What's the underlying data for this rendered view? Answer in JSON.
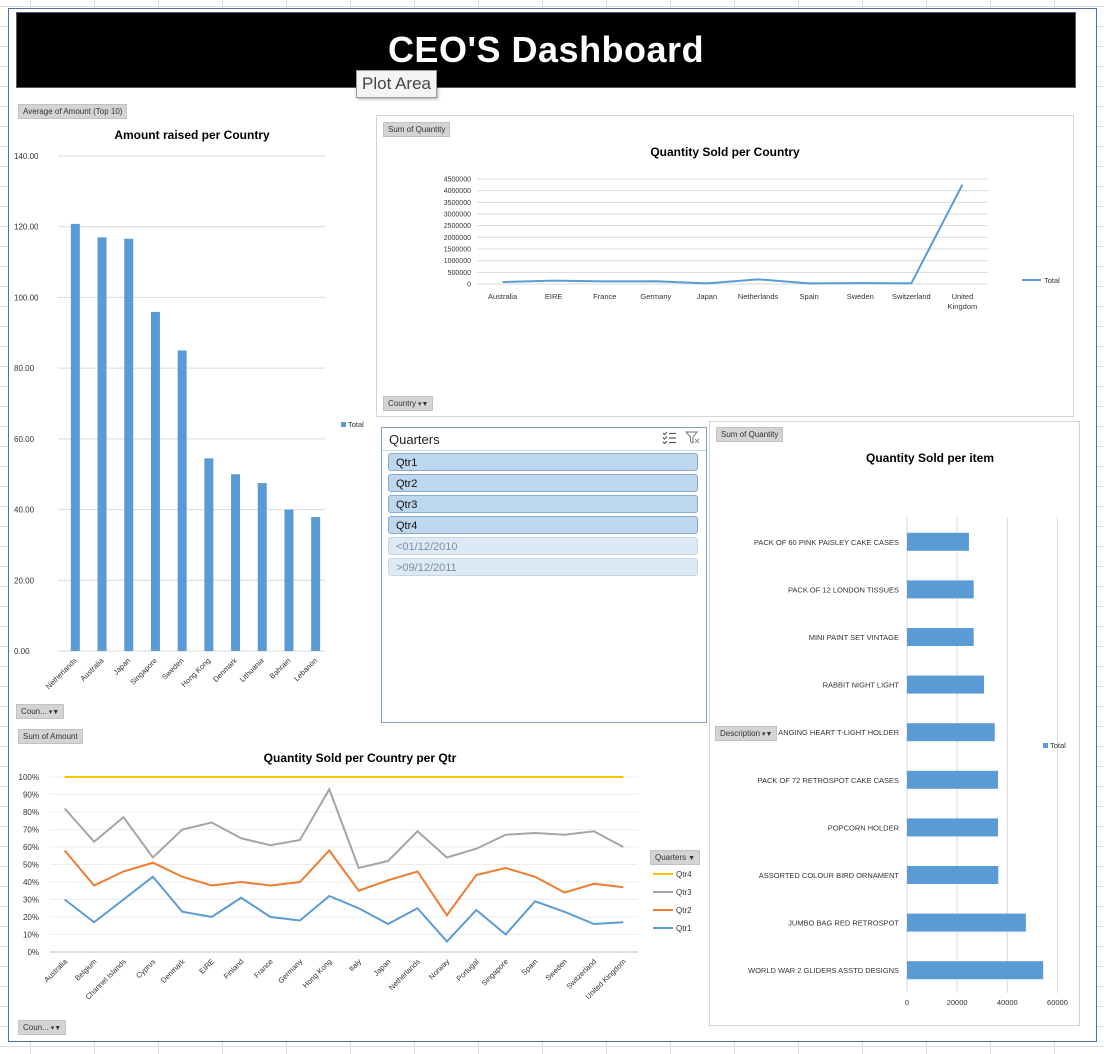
{
  "dashboard": {
    "title": "CEO'S Dashboard",
    "tooltip": "Plot Area"
  },
  "colors": {
    "bar_blue": "#5b9bd5",
    "qtr1": "#5b9bd5",
    "qtr2": "#ed7d31",
    "qtr3": "#a5a5a5",
    "qtr4": "#ffc000",
    "gridline": "#d9d9d9"
  },
  "amount_chart": {
    "field_button": "Average of Amount (Top 10)",
    "axis_button": "Coun...",
    "legend": "Total"
  },
  "quantity_country_chart": {
    "field_button": "Sum of Quantity",
    "axis_button": "Country",
    "legend": "Total"
  },
  "item_chart": {
    "field_button": "Sum of Quantity",
    "axis_button": "Description",
    "legend": "Total"
  },
  "qtr_chart": {
    "field_button": "Sum of Amount",
    "axis_button": "Coun...",
    "legend_button": "Quarters"
  },
  "slicer": {
    "title": "Quarters",
    "icons": [
      "multi-select-icon",
      "clear-filter-icon"
    ],
    "items": [
      {
        "label": "Qtr1",
        "selected": true
      },
      {
        "label": "Qtr2",
        "selected": true
      },
      {
        "label": "Qtr3",
        "selected": true
      },
      {
        "label": "Qtr4",
        "selected": true
      },
      {
        "label": "<01/12/2010",
        "selected": false
      },
      {
        "label": ">09/12/2011",
        "selected": false
      }
    ]
  },
  "chart_data": [
    {
      "type": "bar",
      "title": "Amount raised per Country",
      "categories": [
        "Netherlands",
        "Australia",
        "Japan",
        "Singapore",
        "Sweden",
        "Hong Kong",
        "Denmark",
        "Lithuania",
        "Bahrain",
        "Lebanon"
      ],
      "series": [
        {
          "name": "Total",
          "values": [
            120.8,
            117.0,
            116.6,
            95.9,
            85.0,
            54.5,
            50.0,
            47.5,
            40.0,
            37.9
          ]
        }
      ],
      "yticks": [
        "0.00",
        "20.00",
        "40.00",
        "60.00",
        "80.00",
        "100.00",
        "120.00",
        "140.00"
      ],
      "ylim": [
        0,
        140
      ],
      "legend": "right"
    },
    {
      "type": "line",
      "title": "Quantity Sold per Country",
      "categories": [
        "Australia",
        "EIRE",
        "France",
        "Germany",
        "Japan",
        "Netherlands",
        "Spain",
        "Sweden",
        "Switzerland",
        "United Kingdom"
      ],
      "series": [
        {
          "name": "Total",
          "values": [
            83000,
            142000,
            111000,
            117000,
            26000,
            200000,
            27000,
            36000,
            30000,
            4260000
          ]
        }
      ],
      "yticks": [
        "0",
        "500000",
        "1000000",
        "1500000",
        "2000000",
        "2500000",
        "3000000",
        "3500000",
        "4000000",
        "4500000"
      ],
      "ylim": [
        0,
        4500000
      ],
      "legend": "right"
    },
    {
      "type": "bar",
      "orientation": "horizontal",
      "title": "Quantity Sold per item",
      "categories": [
        "PACK OF 60 PINK PAISLEY CAKE CASES",
        "PACK OF 12 LONDON TISSUES",
        "MINI PAINT SET VINTAGE",
        "RABBIT NIGHT LIGHT",
        "ANGING HEART T-LIGHT HOLDER",
        "PACK OF 72 RETROSPOT CAKE CASES",
        "POPCORN HOLDER",
        "ASSORTED COLOUR BIRD ORNAMENT",
        "JUMBO BAG RED RETROSPOT",
        "WORLD WAR 2 GLIDERS ASSTD DESIGNS"
      ],
      "series": [
        {
          "name": "Total",
          "values": [
            24700,
            26600,
            26600,
            30700,
            35000,
            36300,
            36300,
            36400,
            47400,
            54300
          ]
        }
      ],
      "xticks": [
        "0",
        "20000",
        "40000",
        "60000"
      ],
      "xlim": [
        0,
        63000
      ],
      "legend": "right"
    },
    {
      "type": "line",
      "stacked": "percent",
      "title": "Quantity Sold per Country per Qtr",
      "categories": [
        "Australia",
        "Belgium",
        "Channel Islands",
        "Cyprus",
        "Denmark",
        "EIRE",
        "Finland",
        "France",
        "Germany",
        "Hong Kong",
        "Italy",
        "Japan",
        "Netherlands",
        "Norway",
        "Portugal",
        "Singapore",
        "Spain",
        "Sweden",
        "Switzerland",
        "United Kingdom"
      ],
      "series": [
        {
          "name": "Qtr4",
          "values": [
            100,
            100,
            100,
            100,
            100,
            100,
            100,
            100,
            100,
            100,
            100,
            100,
            100,
            100,
            100,
            100,
            100,
            100,
            100,
            100
          ]
        },
        {
          "name": "Qtr3",
          "values": [
            82,
            63,
            77,
            54,
            70,
            74,
            65,
            61,
            64,
            93,
            48,
            52,
            69,
            54,
            59,
            67,
            68,
            67,
            69,
            60
          ]
        },
        {
          "name": "Qtr2",
          "values": [
            58,
            38,
            46,
            51,
            43,
            38,
            40,
            38,
            40,
            58,
            35,
            41,
            46,
            21,
            44,
            48,
            43,
            34,
            39,
            37
          ]
        },
        {
          "name": "Qtr1",
          "values": [
            30,
            17,
            30,
            43,
            23,
            20,
            31,
            20,
            18,
            32,
            25,
            16,
            25,
            6,
            24,
            10,
            29,
            23,
            16,
            17
          ]
        }
      ],
      "yticks": [
        "0%",
        "10%",
        "20%",
        "30%",
        "40%",
        "50%",
        "60%",
        "70%",
        "80%",
        "90%",
        "100%"
      ],
      "ylim": [
        0,
        100
      ],
      "legend": "right"
    }
  ]
}
